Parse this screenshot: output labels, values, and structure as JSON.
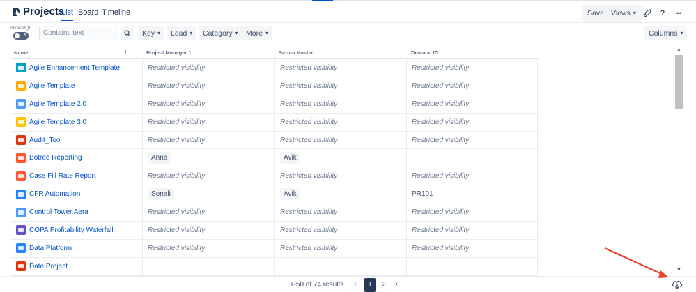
{
  "header": {
    "title": "Projects",
    "tabs": [
      {
        "label": "List",
        "active": true
      },
      {
        "label": "Board",
        "active": false
      },
      {
        "label": "Timeline",
        "active": false
      }
    ],
    "save_label": "Save",
    "views_label": "Views",
    "help_label": "?",
    "more_label": "•••"
  },
  "filters": {
    "show_pql_label": "Show PQL",
    "search_placeholder": "Contains text",
    "buttons": [
      "Key",
      "Lead",
      "Category",
      "More"
    ],
    "columns_label": "Columns"
  },
  "table": {
    "columns": [
      "Name",
      "Project Manager 1",
      "Scrum Master",
      "Demand ID"
    ],
    "rows": [
      {
        "name": "Agile Enhancement Template",
        "icon_color": "#00a3bf",
        "pm": "Restricted visibility",
        "sm": "Restricted visibility",
        "demand": "Restricted visibility"
      },
      {
        "name": "Agile Template",
        "icon_color": "#ffab00",
        "pm": "Restricted visibility",
        "sm": "Restricted visibility",
        "demand": "Restricted visibility"
      },
      {
        "name": "Agile Template 2.0",
        "icon_color": "#4c9aff",
        "pm": "Restricted visibility",
        "sm": "Restricted visibility",
        "demand": "Restricted visibility"
      },
      {
        "name": "Agile Template 3.0",
        "icon_color": "#ffc400",
        "pm": "Restricted visibility",
        "sm": "Restricted visibility",
        "demand": "Restricted visibility"
      },
      {
        "name": "Audit_Tool",
        "icon_color": "#de350b",
        "pm": "Restricted visibility",
        "sm": "Restricted visibility",
        "demand": "Restricted visibility"
      },
      {
        "name": "Botree Reporting",
        "icon_color": "#ff5630",
        "pm": "Anna",
        "sm": "Avik",
        "demand": ""
      },
      {
        "name": "Case Fill Rate Report",
        "icon_color": "#ff5630",
        "pm": "Restricted visibility",
        "sm": "Restricted visibility",
        "demand": "Restricted visibility"
      },
      {
        "name": "CFR Automation",
        "icon_color": "#2684ff",
        "pm": "Sonali",
        "sm": "Avik",
        "demand": "PR101"
      },
      {
        "name": "Control Tower Aera",
        "icon_color": "#4c9aff",
        "pm": "Restricted visibility",
        "sm": "Restricted visibility",
        "demand": "Restricted visibility"
      },
      {
        "name": "COPA Profitability Waterfall",
        "icon_color": "#6554c0",
        "pm": "Restricted visibility",
        "sm": "Restricted visibility",
        "demand": "Restricted visibility"
      },
      {
        "name": "Data Platform",
        "icon_color": "#2684ff",
        "pm": "Restricted visibility",
        "sm": "Restricted visibility",
        "demand": "Restricted visibility"
      },
      {
        "name": "Date Project",
        "icon_color": "#de350b",
        "pm": "",
        "sm": "",
        "demand": ""
      }
    ]
  },
  "pagination": {
    "results_text": "1-50 of 74 results",
    "pages": [
      "1",
      "2"
    ],
    "current_page": "1",
    "prev_arrow": "‹",
    "next_arrow": "›"
  },
  "colors": {
    "accent": "#0052cc",
    "annotation_arrow": "#e8412c"
  }
}
